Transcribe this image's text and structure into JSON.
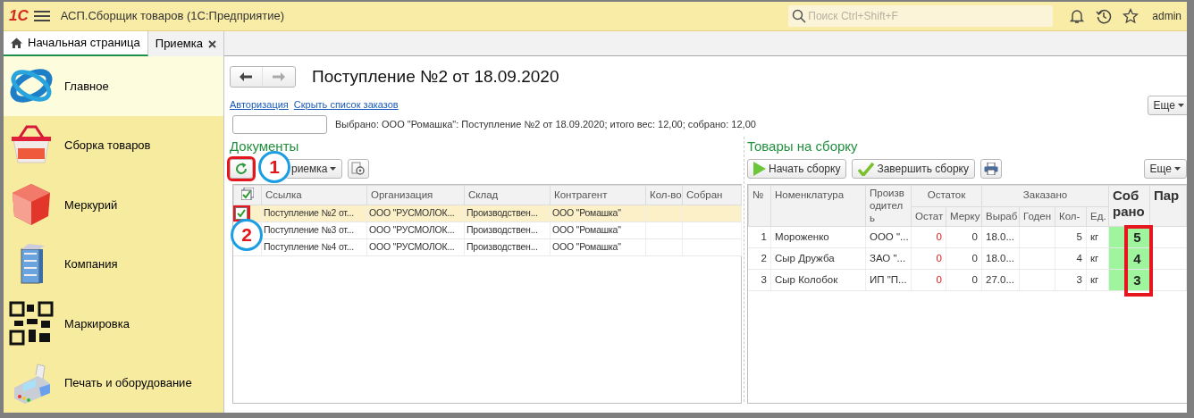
{
  "header": {
    "logo": "1С",
    "app_title": "АСП.Сборщик товаров  (1С:Предприятие)",
    "search": {
      "placeholder": "Поиск Ctrl+Shift+F"
    },
    "user": "admin"
  },
  "tabs": [
    {
      "label": "Начальная страница",
      "kind": "home",
      "selected": true
    },
    {
      "label": "Приемка",
      "kind": "closable",
      "selected": false
    }
  ],
  "sidebar": {
    "items": [
      {
        "label": "Главное",
        "selected": true
      },
      {
        "label": "Сборка товаров",
        "selected": false
      },
      {
        "label": "Меркурий",
        "selected": false
      },
      {
        "label": "Компания",
        "selected": false
      },
      {
        "label": "Маркировка",
        "selected": false
      },
      {
        "label": "Печать и оборудование",
        "selected": false
      }
    ]
  },
  "form": {
    "title": "Поступление №2 от 18.09.2020",
    "links": [
      "Авторизация",
      "Скрыть список заказов"
    ],
    "more_button": "Еще",
    "selected_info": "Выбрано: ООО \"Ромашка\": Поступление №2 от 18.09.2020; итого вес: 12,00; собрано: 12,00"
  },
  "documents": {
    "title": "Документы",
    "refresh_highlighted": true,
    "filter_button": "риемка",
    "columns": [
      "Ссылка",
      "Организация",
      "Склад",
      "Контрагент",
      "Кол-во",
      "Собран"
    ],
    "rows": [
      {
        "cells": [
          "Поступление №2 от...",
          "ООО \"РУСМОЛОК...",
          "Производствен...",
          "ООО \"Ромашка\"",
          "",
          ""
        ],
        "checked": true,
        "selected": true
      },
      {
        "cells": [
          "Поступление №3 от...",
          "ООО \"РУСМОЛОК...",
          "Производствен...",
          "ООО \"Ромашка\"",
          "",
          ""
        ],
        "checked": false,
        "selected": false
      },
      {
        "cells": [
          "Поступление №4 от...",
          "ООО \"РУСМОЛОК...",
          "Производствен...",
          "ООО \"Ромашка\"",
          "",
          ""
        ],
        "checked": false,
        "selected": false
      }
    ]
  },
  "goods": {
    "title": "Товары на сборку",
    "buttons": [
      "Начать сборку",
      "Завершить сборку"
    ],
    "more_button": "Еще",
    "collected_highlighted": true,
    "columns": {
      "number": "№",
      "name": "Номенклатура",
      "producer": "Производитель",
      "stock_group": "Остаток",
      "stock": [
        "Остат",
        "Мерку"
      ],
      "ordered_group": "Заказано",
      "ordered": [
        "Выраб",
        "Годен",
        "Кол-",
        "Ед."
      ],
      "collected": "Собрано",
      "column_12": "Пар"
    },
    "rows": [
      {
        "number": "1",
        "name": "Мороженко",
        "producer": "ООО \"...",
        "stock": "0",
        "stock_alert": true,
        "mercury": "0",
        "made": "18.0...",
        "expires": "",
        "qty": "5",
        "unit": "кг",
        "collected": "5"
      },
      {
        "number": "2",
        "name": "Сыр Дружба",
        "producer": "ЗАО \"...",
        "stock": "0",
        "stock_alert": true,
        "mercury": "0",
        "made": "18.0...",
        "expires": "",
        "qty": "4",
        "unit": "кг",
        "collected": "4"
      },
      {
        "number": "3",
        "name": "Сыр Колобок",
        "producer": "ИП \"П...",
        "stock": "0",
        "stock_alert": true,
        "mercury": "0",
        "made": "27.0...",
        "expires": "",
        "qty": "3",
        "unit": "кг",
        "collected": "3"
      }
    ]
  },
  "callouts": [
    {
      "number": "1"
    },
    {
      "number": "2"
    }
  ]
}
